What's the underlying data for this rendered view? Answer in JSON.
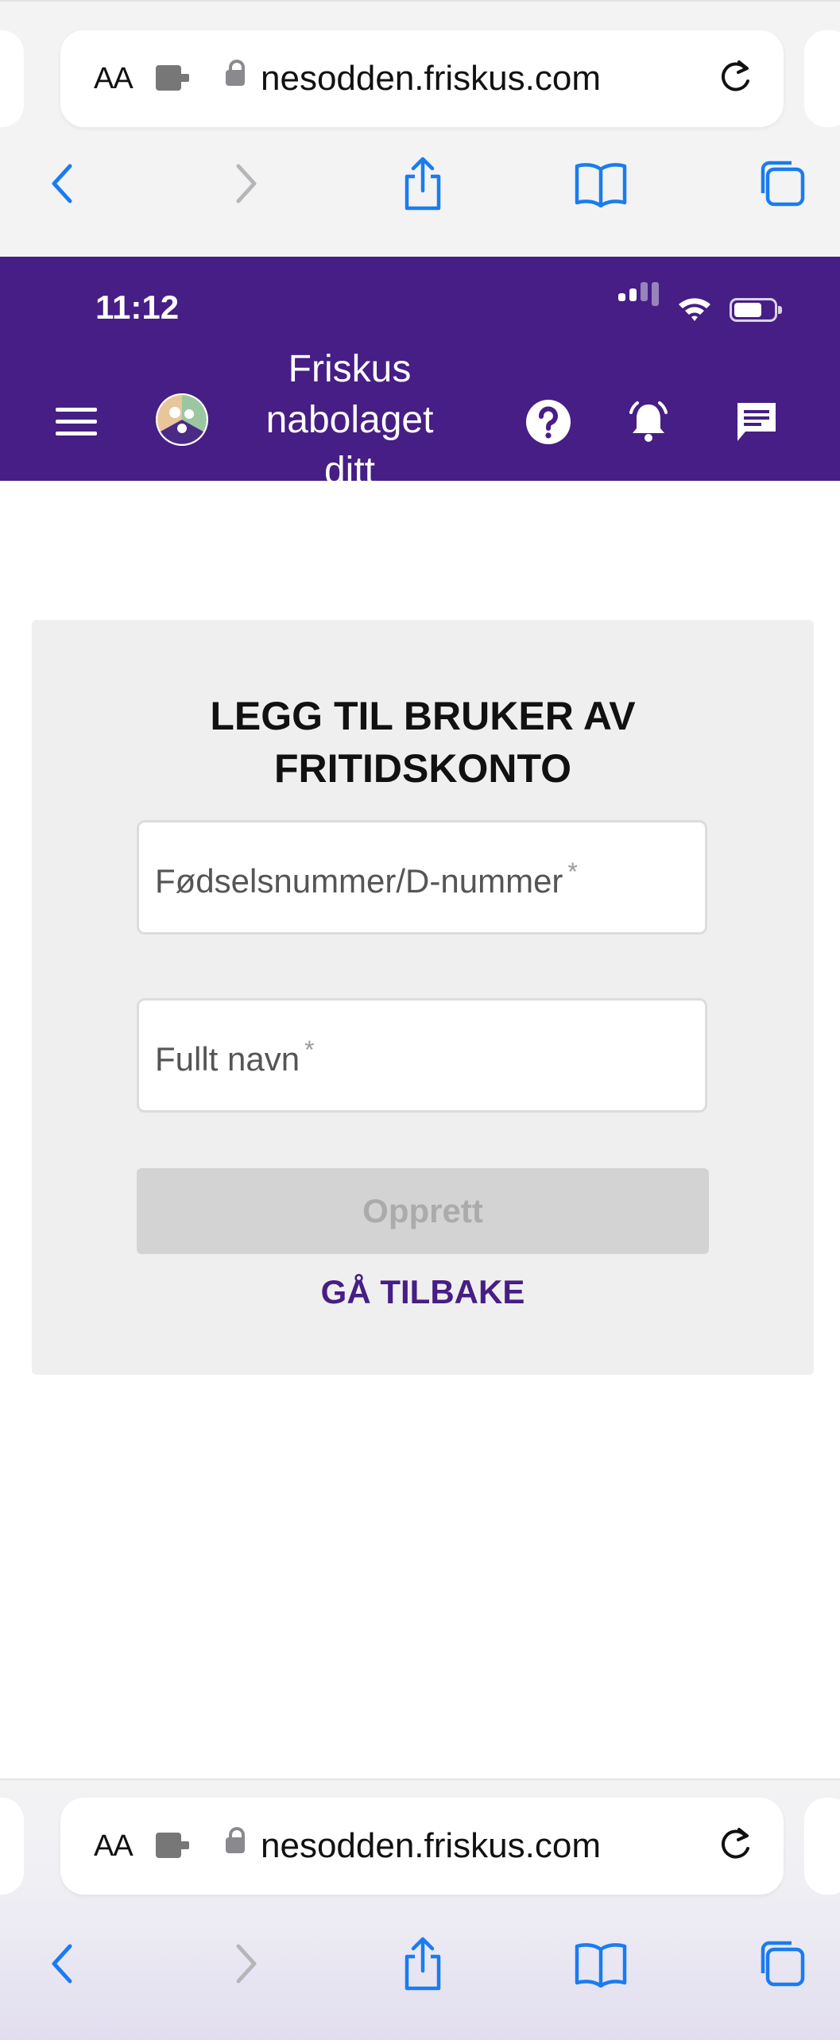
{
  "browser": {
    "text_size_label": "AA",
    "url": "nesodden.friskus.com"
  },
  "status_bar": {
    "time": "11:12"
  },
  "app_header": {
    "brand_name": "Friskus nabolaget ditt",
    "bg_color": "#461e85"
  },
  "form": {
    "title": "LEGG TIL BRUKER AV FRITIDSKONTO",
    "id_field": {
      "placeholder": "Fødselsnummer/D-nummer",
      "required_mark": "*",
      "value": ""
    },
    "name_field": {
      "placeholder": "Fullt navn",
      "required_mark": "*",
      "value": ""
    },
    "submit_label": "Opprett",
    "back_label": "GÅ TILBAKE"
  },
  "colors": {
    "accent": "#461e85",
    "ios_blue": "#1a7cf0",
    "card_bg": "#efefef",
    "disabled_button": "#d3d3d3"
  },
  "icons": {
    "toolbar": [
      "back-arrow-icon",
      "forward-arrow-icon",
      "share-icon",
      "bookmarks-icon",
      "tabs-icon"
    ],
    "header": [
      "menu-icon",
      "help-icon",
      "notification-bell-icon",
      "message-icon"
    ]
  }
}
